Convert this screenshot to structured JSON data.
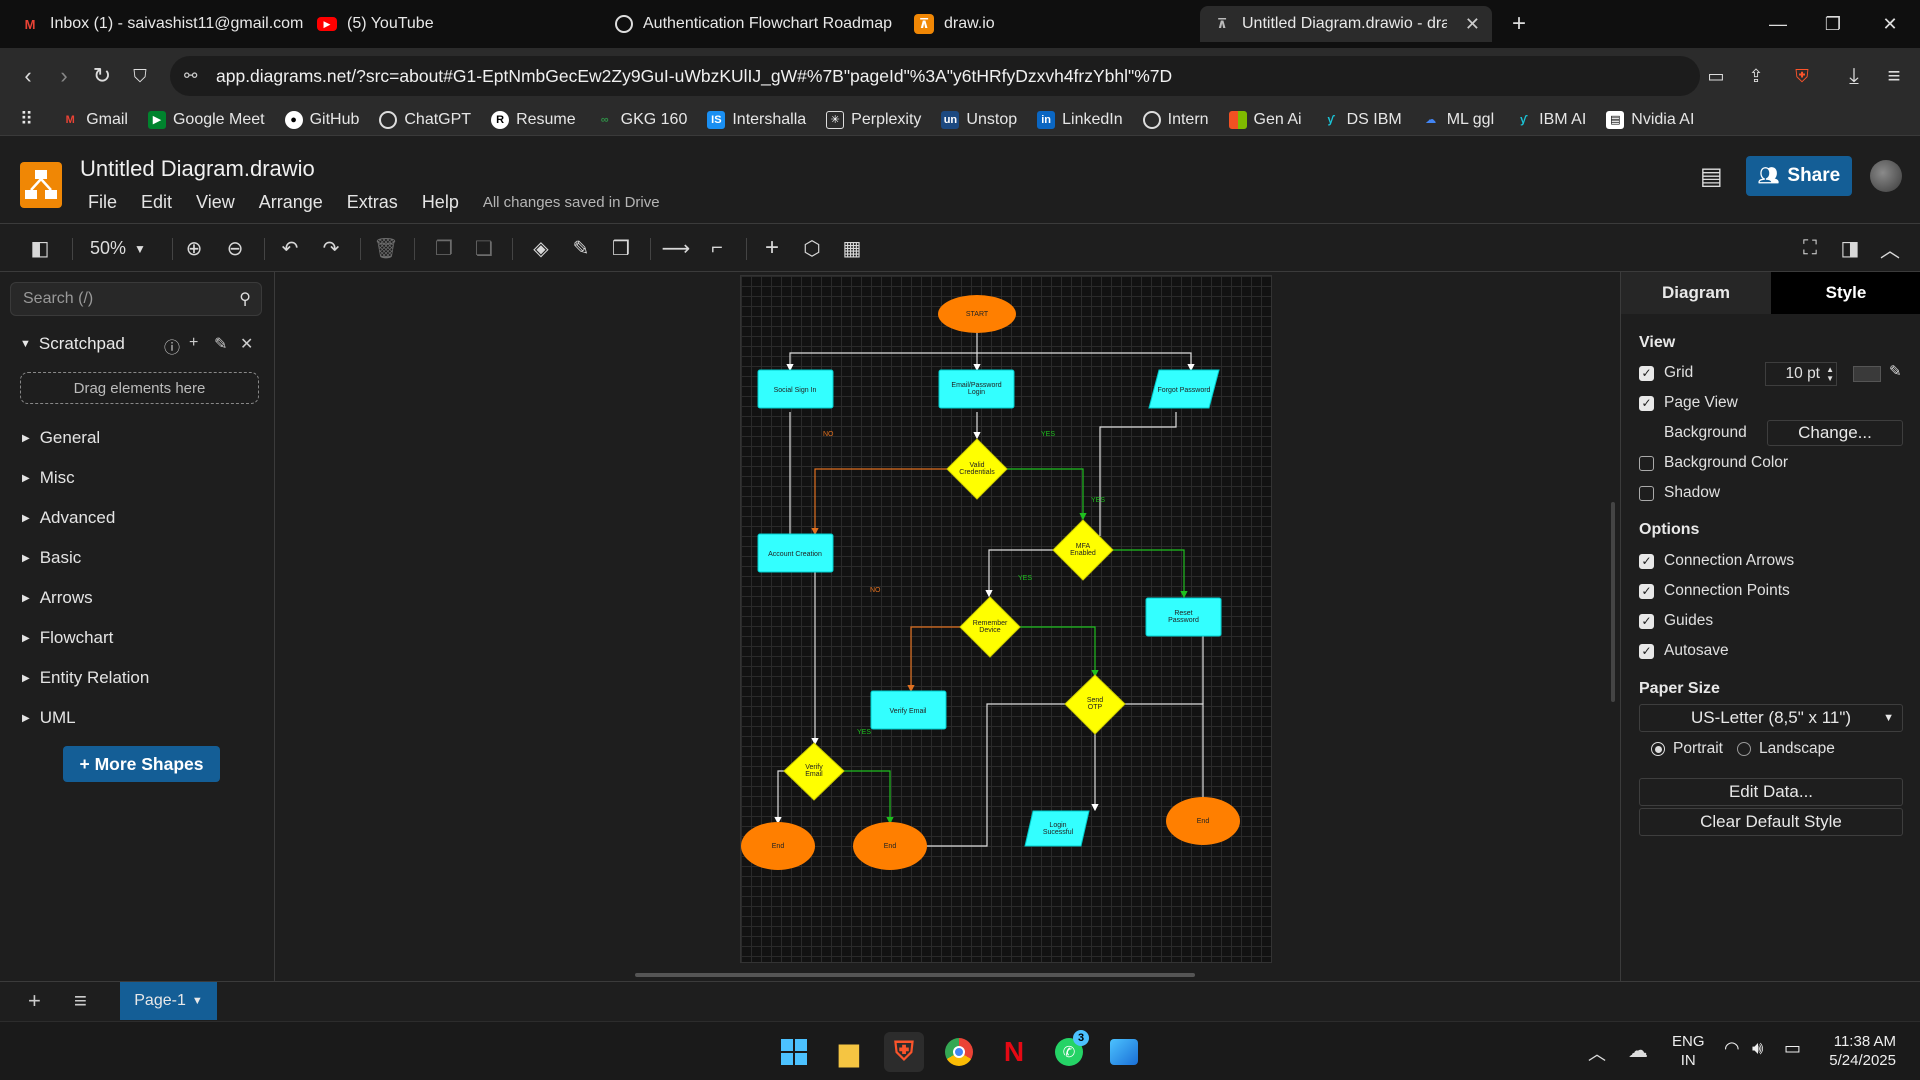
{
  "browser": {
    "tabs": [
      {
        "label": "Inbox (1) - saivashist11@gmail.com",
        "icon": "gmail-icon"
      },
      {
        "label": "(5) YouTube",
        "icon": "youtube-icon"
      },
      {
        "label": "Authentication Flowchart Roadmap",
        "icon": "chatgpt-icon"
      },
      {
        "label": "draw.io",
        "icon": "drawio-icon"
      },
      {
        "label": "Untitled Diagram.drawio - draw.io",
        "icon": "drawio-icon",
        "active": true
      }
    ],
    "url": "app.diagrams.net/?src=about#G1-EptNmbGecEw2Zy9GuI-uWbzKUlIJ_gW#%7B\"pageId\"%3A\"y6tHRfyDzxvh4frzYbhl\"%7D",
    "bookmarks": [
      "Gmail",
      "Google Meet",
      "GitHub",
      "ChatGPT",
      "Resume",
      "GKG 160",
      "Intershalla",
      "Perplexity",
      "Unstop",
      "LinkedIn",
      "Intern",
      "Gen Ai",
      "DS IBM",
      "ML ggl",
      "IBM AI",
      "Nvidia AI"
    ]
  },
  "app": {
    "title": "Untitled Diagram.drawio",
    "menus": [
      "File",
      "Edit",
      "View",
      "Arrange",
      "Extras",
      "Help"
    ],
    "save_status": "All changes saved in Drive",
    "share_label": "Share",
    "zoom": "50%"
  },
  "left_panel": {
    "search_placeholder": "Search (/)",
    "scratchpad_label": "Scratchpad",
    "drag_hint": "Drag elements here",
    "categories": [
      "General",
      "Misc",
      "Advanced",
      "Basic",
      "Arrows",
      "Flowchart",
      "Entity Relation",
      "UML"
    ],
    "more_shapes": "+ More Shapes"
  },
  "diagram": {
    "nodes": {
      "start": "START",
      "social": "Social Sign In",
      "emailpw": "Email/Password Login",
      "forgot": "Forgot Password",
      "valid": "Valid Credentials",
      "account": "Account Creation",
      "mfa": "MFA Enabled",
      "reset": "Reset Password",
      "remember": "Remember Device",
      "verifyemail": "Verify Email",
      "sendotp": "Send OTP",
      "verifyemail2": "Verify Email",
      "end1": "End",
      "end2": "End",
      "login": "Login Sucessful",
      "end3": "End"
    },
    "edge_labels": {
      "no1": "NO",
      "yes1": "YES",
      "yes2": "YES",
      "no2": "NO",
      "yes3": "YES",
      "yes4": "YES"
    }
  },
  "right_panel": {
    "tabs": [
      "Diagram",
      "Style"
    ],
    "view_heading": "View",
    "grid_label": "Grid",
    "grid_size": "10 pt",
    "page_view_label": "Page View",
    "background_label": "Background",
    "change_label": "Change...",
    "background_color_label": "Background Color",
    "shadow_label": "Shadow",
    "options_heading": "Options",
    "connection_arrows_label": "Connection Arrows",
    "connection_points_label": "Connection Points",
    "guides_label": "Guides",
    "autosave_label": "Autosave",
    "paper_size_heading": "Paper Size",
    "paper_size_value": "US-Letter (8,5\" x 11\")",
    "portrait_label": "Portrait",
    "landscape_label": "Landscape",
    "edit_data_label": "Edit Data...",
    "clear_style_label": "Clear Default Style",
    "checks": {
      "grid": true,
      "page_view": true,
      "background_color": false,
      "shadow": false,
      "connection_arrows": true,
      "connection_points": true,
      "guides": true,
      "autosave": true
    },
    "orientation": "Portrait"
  },
  "page_bar": {
    "page_label": "Page-1"
  },
  "taskbar": {
    "lang": "ENG",
    "region": "IN",
    "time": "11:38 AM",
    "date": "5/24/2025",
    "whatsapp_badge": "3"
  },
  "colors": {
    "accent": "#145e96",
    "terminal": "#ff7f00",
    "process": "#33ffff",
    "decision": "#ffff00",
    "yes_edge": "#1fbf1f",
    "no_edge": "#e07020"
  }
}
